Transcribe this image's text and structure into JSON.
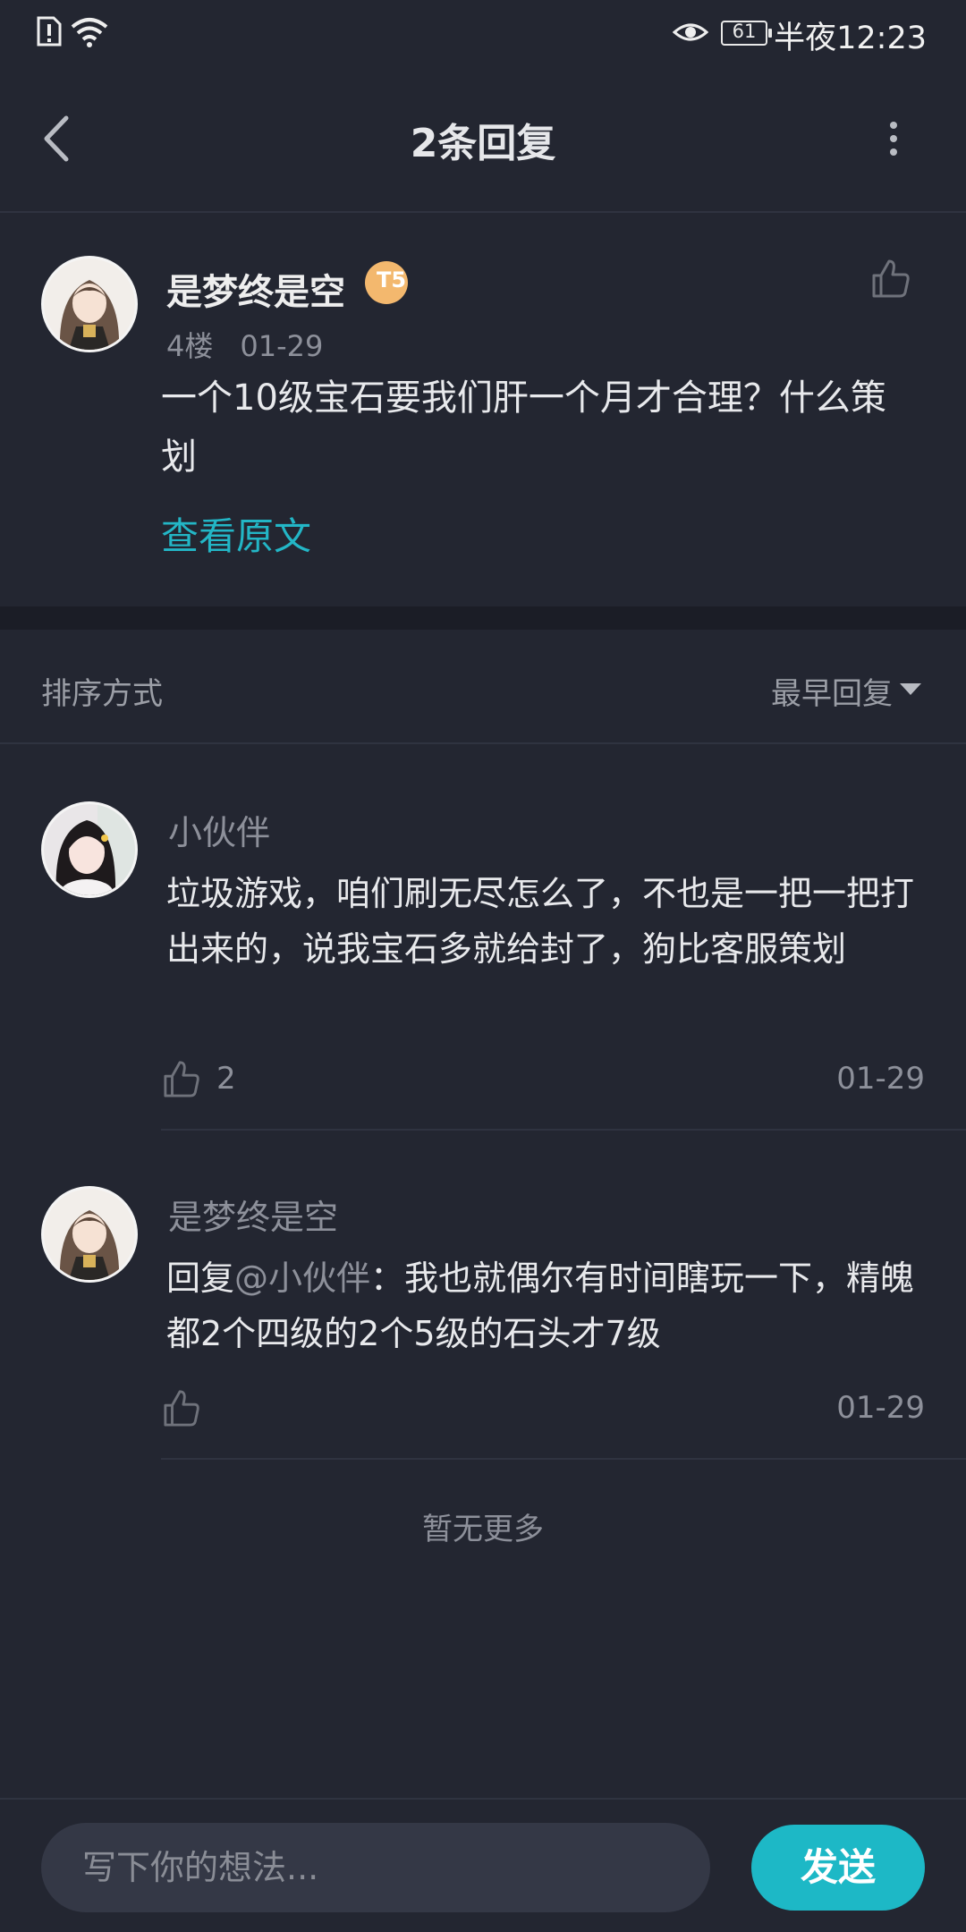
{
  "status_bar": {
    "battery": "61",
    "time": "半夜12:23"
  },
  "header": {
    "title": "2条回复"
  },
  "post": {
    "username": "是梦终是空",
    "level_badge": "T5",
    "floor": "4楼",
    "date": "01-29",
    "content": "一个10级宝石要我们肝一个月才合理？什么策划",
    "view_original": "查看原文"
  },
  "sort": {
    "label": "排序方式",
    "value": "最早回复"
  },
  "replies": [
    {
      "username": "小伙伴",
      "content": "垃圾游戏，咱们刷无尽怎么了，不也是一把一把打出来的，说我宝石多就给封了，狗比客服策划",
      "likes": "2",
      "date": "01-29"
    },
    {
      "username": "是梦终是空",
      "reply_prefix": "回复",
      "mention": "@小伙伴",
      "content": "：我也就偶尔有时间瞎玩一下，精魄都2个四级的2个5级的石头才7级",
      "likes": "",
      "date": "01-29"
    }
  ],
  "footer_note": "暂无更多",
  "composer": {
    "placeholder": "写下你的想法...",
    "send_label": "发送"
  }
}
